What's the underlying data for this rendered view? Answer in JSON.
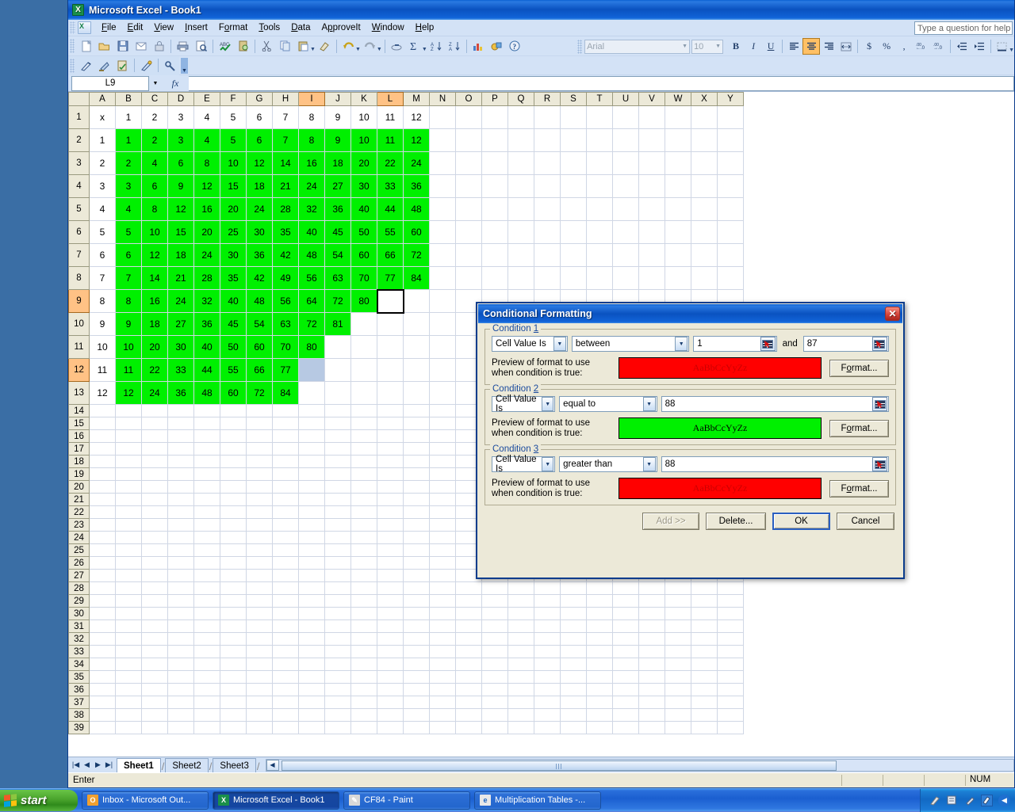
{
  "window": {
    "title": "Microsoft Excel - Book1",
    "app_icon": "excel-icon"
  },
  "menubar": {
    "items": [
      {
        "label": "File",
        "accel": "F"
      },
      {
        "label": "Edit",
        "accel": "E"
      },
      {
        "label": "View",
        "accel": "V"
      },
      {
        "label": "Insert",
        "accel": "I"
      },
      {
        "label": "Format",
        "accel": "o"
      },
      {
        "label": "Tools",
        "accel": "T"
      },
      {
        "label": "Data",
        "accel": "D"
      },
      {
        "label": "ApproveIt",
        "accel": "p"
      },
      {
        "label": "Window",
        "accel": "W"
      },
      {
        "label": "Help",
        "accel": "H"
      }
    ],
    "ask_placeholder": "Type a question for help"
  },
  "standard_toolbar": {
    "buttons": [
      "new-icon",
      "open-icon",
      "save-icon",
      "mail-icon",
      "permission-icon",
      "print-icon",
      "print-preview-icon",
      "spelling-icon",
      "research-icon",
      "cut-icon",
      "copy-icon",
      "paste-icon",
      "format-painter-icon",
      "undo-icon",
      "redo-icon",
      "hyperlink-icon",
      "autosum-icon",
      "sort-asc-icon",
      "sort-desc-icon",
      "chart-wizard-icon",
      "drawing-icon",
      "help-icon"
    ]
  },
  "approveit_toolbar": {
    "buttons": [
      "sign-icon",
      "clear-signature-icon",
      "verify-icon",
      "stamp-icon",
      "settings-icon"
    ]
  },
  "formatting_toolbar": {
    "font_name": "Arial",
    "font_size": "10",
    "bold_label": "B",
    "italic_label": "I",
    "underline_label": "U",
    "align_left": "align-left-icon",
    "align_center": "align-center-icon",
    "align_right": "align-right-icon",
    "merge_center": "merge-center-icon",
    "currency_label": "$",
    "percent_label": "%",
    "comma_label": ",",
    "increase_decimal": "increase-decimal-icon",
    "decrease_decimal": "decrease-decimal-icon",
    "decrease_indent": "decrease-indent-icon",
    "increase_indent": "increase-indent-icon",
    "borders": "borders-icon",
    "active_button": "align-center-icon"
  },
  "formula_bar": {
    "name_box": "L9",
    "fx_label": "fx",
    "formula_value": ""
  },
  "grid": {
    "column_headers": [
      "A",
      "B",
      "C",
      "D",
      "E",
      "F",
      "G",
      "H",
      "I",
      "J",
      "K",
      "L",
      "M",
      "N",
      "O",
      "P",
      "Q",
      "R",
      "S",
      "T",
      "U",
      "V",
      "W",
      "X",
      "Y"
    ],
    "selected_columns": [
      "I",
      "L"
    ],
    "selected_rows": [
      9,
      12
    ],
    "row_numbers": [
      1,
      2,
      3,
      4,
      5,
      6,
      7,
      8,
      9,
      10,
      11,
      12,
      13,
      14,
      15,
      16,
      17,
      18,
      19,
      20,
      21,
      22,
      23,
      24,
      25,
      26,
      27,
      28,
      29,
      30,
      31,
      32,
      33,
      34,
      35,
      36,
      37,
      38,
      39
    ],
    "active_cell": "L9",
    "blue_selected_cell": "I12",
    "table_rows": [
      {
        "label": "x",
        "values": [
          "1",
          "2",
          "3",
          "4",
          "5",
          "6",
          "7",
          "8",
          "9",
          "10",
          "11",
          "12"
        ],
        "green_upto": 0
      },
      {
        "label": "1",
        "values": [
          "1",
          "2",
          "3",
          "4",
          "5",
          "6",
          "7",
          "8",
          "9",
          "10",
          "11",
          "12"
        ],
        "green_upto": 12
      },
      {
        "label": "2",
        "values": [
          "2",
          "4",
          "6",
          "8",
          "10",
          "12",
          "14",
          "16",
          "18",
          "20",
          "22",
          "24"
        ],
        "green_upto": 12
      },
      {
        "label": "3",
        "values": [
          "3",
          "6",
          "9",
          "12",
          "15",
          "18",
          "21",
          "24",
          "27",
          "30",
          "33",
          "36"
        ],
        "green_upto": 12
      },
      {
        "label": "4",
        "values": [
          "4",
          "8",
          "12",
          "16",
          "20",
          "24",
          "28",
          "32",
          "36",
          "40",
          "44",
          "48"
        ],
        "green_upto": 12
      },
      {
        "label": "5",
        "values": [
          "5",
          "10",
          "15",
          "20",
          "25",
          "30",
          "35",
          "40",
          "45",
          "50",
          "55",
          "60"
        ],
        "green_upto": 12
      },
      {
        "label": "6",
        "values": [
          "6",
          "12",
          "18",
          "24",
          "30",
          "36",
          "42",
          "48",
          "54",
          "60",
          "66",
          "72"
        ],
        "green_upto": 12
      },
      {
        "label": "7",
        "values": [
          "7",
          "14",
          "21",
          "28",
          "35",
          "42",
          "49",
          "56",
          "63",
          "70",
          "77",
          "84"
        ],
        "green_upto": 12
      },
      {
        "label": "8",
        "values": [
          "8",
          "16",
          "24",
          "32",
          "40",
          "48",
          "56",
          "64",
          "72",
          "80",
          "",
          ""
        ],
        "green_upto": 10
      },
      {
        "label": "9",
        "values": [
          "9",
          "18",
          "27",
          "36",
          "45",
          "54",
          "63",
          "72",
          "81",
          "",
          "",
          ""
        ],
        "green_upto": 9
      },
      {
        "label": "10",
        "values": [
          "10",
          "20",
          "30",
          "40",
          "50",
          "60",
          "70",
          "80",
          "",
          "",
          "",
          ""
        ],
        "green_upto": 8
      },
      {
        "label": "11",
        "values": [
          "11",
          "22",
          "33",
          "44",
          "55",
          "66",
          "77",
          "",
          "",
          "",
          "",
          ""
        ],
        "green_upto": 7
      },
      {
        "label": "12",
        "values": [
          "12",
          "24",
          "36",
          "48",
          "60",
          "72",
          "84",
          "",
          "",
          "",
          "",
          ""
        ],
        "green_upto": 7
      }
    ]
  },
  "sheet_tabs": {
    "nav_first": "first-sheet-icon",
    "nav_prev": "prev-sheet-icon",
    "nav_next": "next-sheet-icon",
    "nav_last": "last-sheet-icon",
    "tabs": [
      {
        "label": "Sheet1",
        "active": true
      },
      {
        "label": "Sheet2",
        "active": false
      },
      {
        "label": "Sheet3",
        "active": false
      }
    ]
  },
  "status_bar": {
    "mode": "Enter",
    "num_lock": "NUM"
  },
  "dialog": {
    "title": "Conditional Formatting",
    "close_label": "✕",
    "preview_label_line1": "Preview of format to use",
    "preview_label_line2": "when condition is true:",
    "preview_sample_text": "AaBbCcYyZz",
    "format_button": "Format...",
    "and_label": "and",
    "conditions": [
      {
        "legend": "Condition 1",
        "legend_num": "1",
        "type": "Cell Value Is",
        "operator": "between",
        "value1": "1",
        "value2": "87",
        "has_second_value": true,
        "preview_bg": "#ff0000",
        "preview_fg": "#cc0000"
      },
      {
        "legend": "Condition 2",
        "legend_num": "2",
        "type": "Cell Value Is",
        "operator": "equal to",
        "value1": "88",
        "value2": "",
        "has_second_value": false,
        "preview_bg": "#00f000",
        "preview_fg": "#000000"
      },
      {
        "legend": "Condition 3",
        "legend_num": "3",
        "type": "Cell Value Is",
        "operator": "greater than",
        "value1": "88",
        "value2": "",
        "has_second_value": false,
        "preview_bg": "#ff0000",
        "preview_fg": "#cc0000"
      }
    ],
    "buttons": {
      "add": "Add >>",
      "add_enabled": false,
      "delete": "Delete...",
      "ok": "OK",
      "cancel": "Cancel"
    }
  },
  "taskbar": {
    "start_label": "start",
    "tasks": [
      {
        "label": "Inbox - Microsoft Out...",
        "icon": "outlook-icon",
        "active": false
      },
      {
        "label": "Microsoft Excel - Book1",
        "icon": "excel-icon",
        "active": true
      },
      {
        "label": "CF84 - Paint",
        "icon": "paint-icon",
        "active": false
      },
      {
        "label": "Multiplication Tables -...",
        "icon": "browser-icon",
        "active": false
      }
    ],
    "tray_icons": [
      "pen-icon",
      "notes-icon",
      "marker-icon",
      "signature-icon",
      "show-desktop-icon"
    ]
  },
  "colors": {
    "green_fill": "#00f000",
    "red_fill": "#ff0000",
    "selection_blue": "#b7c9e3",
    "header_selected": "#ffc285"
  }
}
